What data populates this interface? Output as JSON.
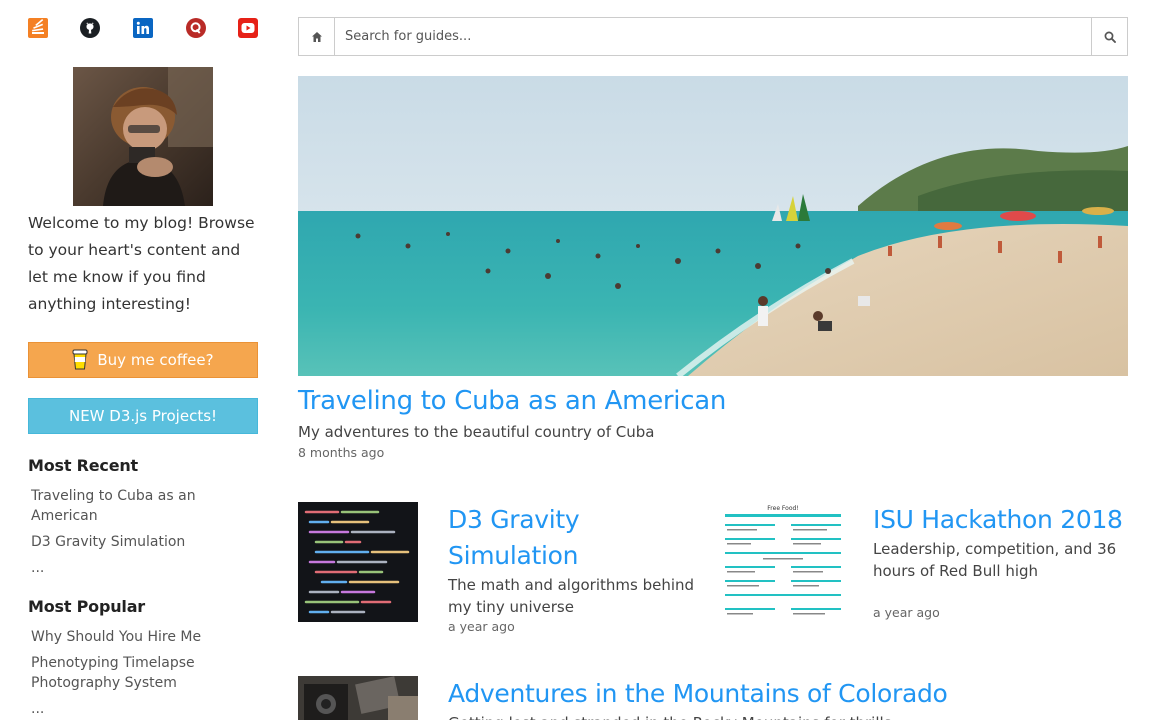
{
  "social": [
    {
      "icon": "stackoverflow-icon"
    },
    {
      "icon": "github-icon"
    },
    {
      "icon": "linkedin-icon"
    },
    {
      "icon": "quora-icon"
    },
    {
      "icon": "youtube-icon"
    }
  ],
  "sidebar": {
    "welcome": "Welcome to my blog! Browse to your heart's content and let me know if you find anything interesting!",
    "coffee_label": "Buy me coffee?",
    "d3_label": "NEW D3.js Projects!",
    "recent_heading": "Most Recent",
    "recent_items": [
      "Traveling to Cuba as an American",
      "D3 Gravity Simulation",
      "..."
    ],
    "popular_heading": "Most Popular",
    "popular_items": [
      "Why Should You Hire Me",
      "Phenotyping Timelapse Photography System",
      "..."
    ]
  },
  "search": {
    "placeholder": "Search for guides..."
  },
  "hero": {
    "title": "Traveling to Cuba as an American",
    "subtitle": "My adventures to the beautiful country of Cuba",
    "date": "8 months ago"
  },
  "posts": [
    {
      "title": "D3 Gravity Simulation",
      "subtitle": "The math and algorithms behind my tiny universe",
      "date": "a year ago"
    },
    {
      "title": "ISU Hackathon 2018",
      "subtitle": "Leadership, competition, and 36 hours of Red Bull high",
      "date": "a year ago"
    },
    {
      "title": "Adventures in the Mountains of Colorado",
      "subtitle": "Getting lost and stranded in the Rocky Mountains for thrills"
    }
  ],
  "thumb_texts": {
    "hackathon_header": "Free Food!"
  },
  "colors": {
    "link_blue": "#2196f3",
    "coffee_orange": "#f5a64e",
    "d3_cyan": "#5bc0de"
  }
}
